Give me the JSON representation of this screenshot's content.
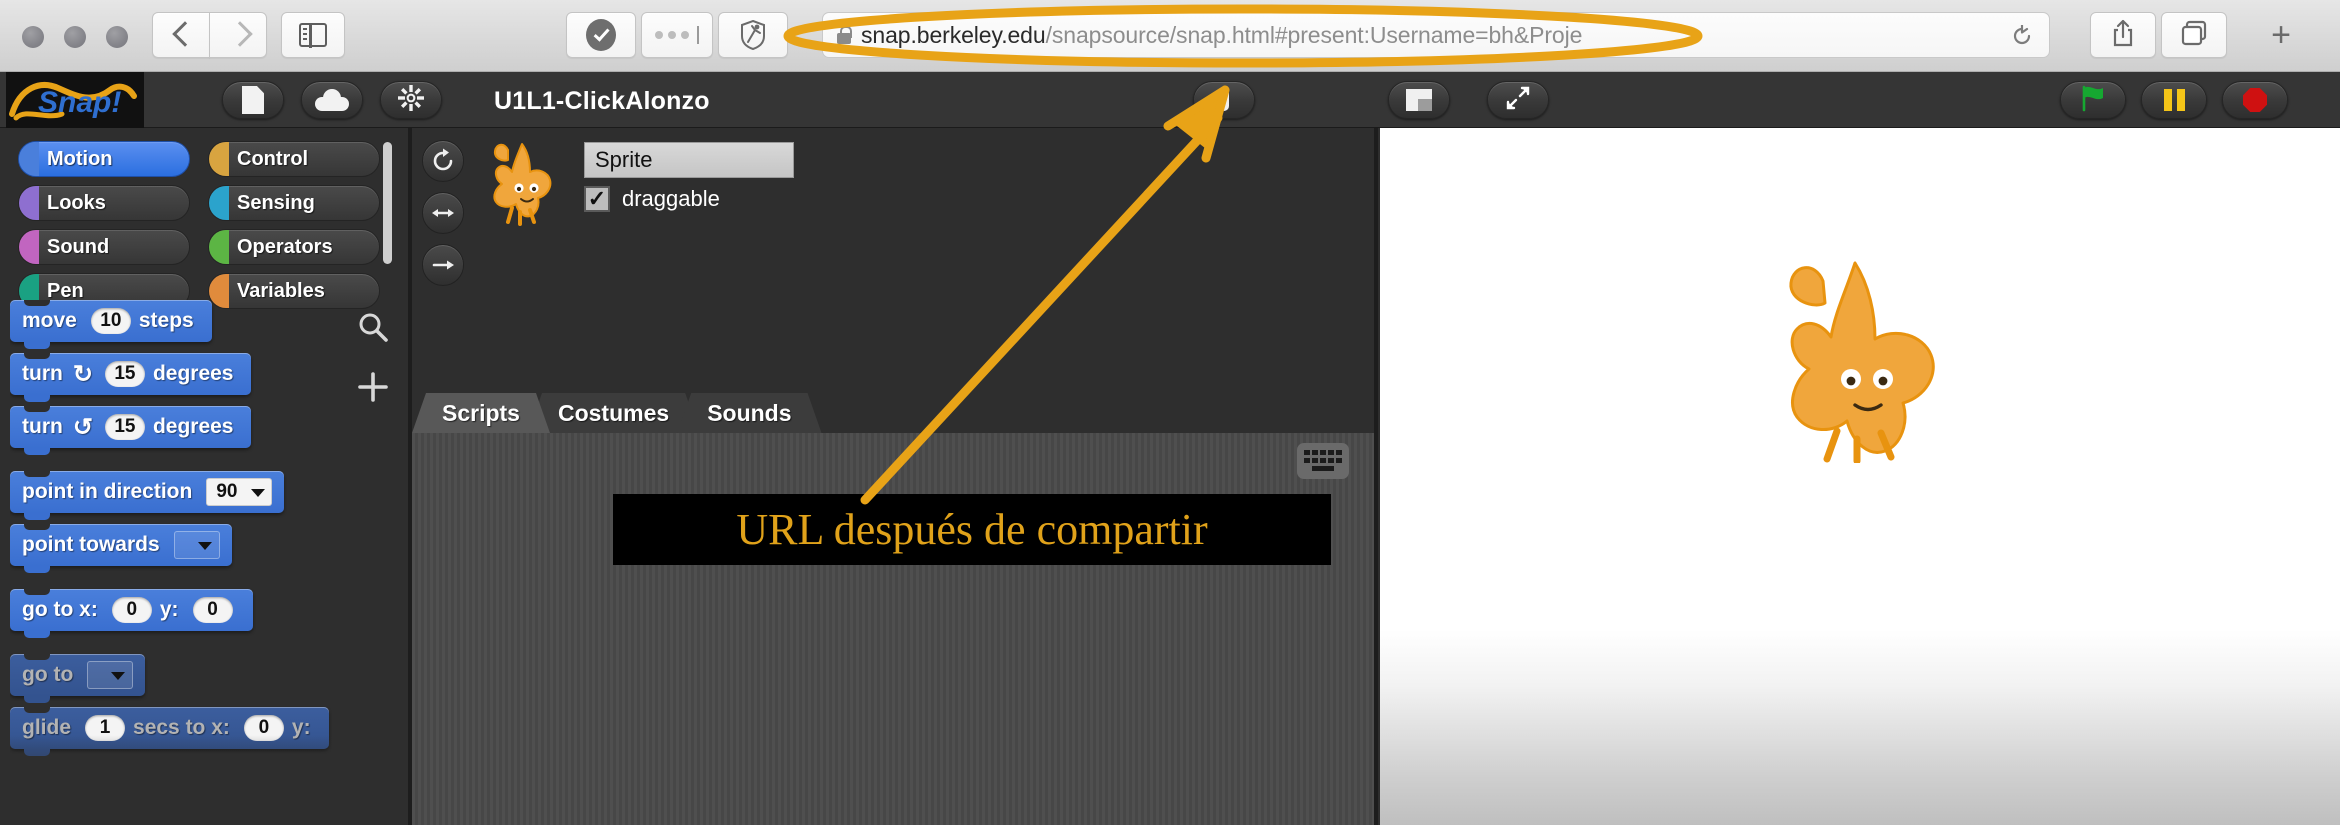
{
  "browser": {
    "traffic_lights": [
      "close",
      "minimize",
      "zoom"
    ],
    "nav": {
      "back": "back-icon",
      "forward": "forward-icon",
      "sidebar": "sidebar-icon"
    },
    "toolbar_icons": [
      "checkmark-circle-icon",
      "three-dots-icon",
      "shield-runner-icon"
    ],
    "address": {
      "lock": "lock-icon",
      "domain": "snap.berkeley.edu",
      "path": "/snapsource/snap.html#present:Username=bh&Proje",
      "full": "snap.berkeley.edu/snapsource/snap.html#present:Username=bh&Proje",
      "reload": "reload-icon"
    },
    "right_icons": [
      "share-icon",
      "tabs-icon",
      "new-tab-plus-icon"
    ]
  },
  "snap": {
    "logo": "snap-logo",
    "toolbar": {
      "file_button": "file-icon",
      "cloud_button": "cloud-icon",
      "settings_button": "gear-icon",
      "project_title": "U1L1-ClickAlonzo",
      "visible_stepping_button": "stepping-icon",
      "stage_size_button": "stage-size-icon",
      "fullscreen_button": "fullscreen-icon",
      "green_flag_button": "green-flag-icon",
      "pause_button": "pause-icon",
      "stop_button": "stop-icon"
    },
    "palette": {
      "categories": [
        {
          "label": "Motion",
          "color": "#4a7fdb",
          "selected": true
        },
        {
          "label": "Control",
          "color": "#d8a440",
          "selected": false
        },
        {
          "label": "Looks",
          "color": "#8e6fd0",
          "selected": false
        },
        {
          "label": "Sensing",
          "color": "#2ba3cc",
          "selected": false
        },
        {
          "label": "Sound",
          "color": "#c165c0",
          "selected": false
        },
        {
          "label": "Operators",
          "color": "#5cb544",
          "selected": false
        },
        {
          "label": "Pen",
          "color": "#1aa182",
          "selected": false
        },
        {
          "label": "Variables",
          "color": "#e08b3c",
          "selected": false
        }
      ],
      "tools": [
        "search-icon",
        "plus-icon"
      ],
      "blocks": [
        {
          "id": "move",
          "parts": [
            {
              "t": "text",
              "v": "move"
            },
            {
              "t": "num",
              "v": "10"
            },
            {
              "t": "text",
              "v": "steps"
            }
          ],
          "dim": false
        },
        {
          "id": "turn-right",
          "parts": [
            {
              "t": "text",
              "v": "turn"
            },
            {
              "t": "icon",
              "v": "↻"
            },
            {
              "t": "num",
              "v": "15"
            },
            {
              "t": "text",
              "v": "degrees"
            }
          ],
          "dim": false
        },
        {
          "id": "turn-left",
          "parts": [
            {
              "t": "text",
              "v": "turn"
            },
            {
              "t": "icon",
              "v": "↺"
            },
            {
              "t": "num",
              "v": "15"
            },
            {
              "t": "text",
              "v": "degrees"
            }
          ],
          "dim": false
        },
        {
          "id": "point-in-direction",
          "parts": [
            {
              "t": "text",
              "v": "point in direction"
            },
            {
              "t": "dropnum",
              "v": "90"
            }
          ],
          "dim": false
        },
        {
          "id": "point-towards",
          "parts": [
            {
              "t": "text",
              "v": "point towards"
            },
            {
              "t": "drop",
              "v": ""
            }
          ],
          "dim": false
        },
        {
          "id": "go-to-xy",
          "parts": [
            {
              "t": "text",
              "v": "go to x:"
            },
            {
              "t": "num",
              "v": "0"
            },
            {
              "t": "text",
              "v": "y:"
            },
            {
              "t": "num",
              "v": "0"
            }
          ],
          "dim": false
        },
        {
          "id": "go-to",
          "parts": [
            {
              "t": "text",
              "v": "go to"
            },
            {
              "t": "drop",
              "v": ""
            }
          ],
          "dim": true
        },
        {
          "id": "glide",
          "parts": [
            {
              "t": "text",
              "v": "glide"
            },
            {
              "t": "num",
              "v": "1"
            },
            {
              "t": "text",
              "v": "secs to x:"
            },
            {
              "t": "num",
              "v": "0"
            },
            {
              "t": "text",
              "v": "y:"
            }
          ],
          "dim": true
        }
      ]
    },
    "sprite": {
      "rotation_buttons": [
        "rotate-freely-icon",
        "rotate-left-right-icon",
        "rotate-none-icon"
      ],
      "thumbnail": "alonzo-sprite-icon",
      "name": "Sprite",
      "draggable_checked": true,
      "draggable_label": "draggable",
      "checkbox_glyph": "✓"
    },
    "tabs": [
      {
        "label": "Scripts",
        "active": true
      },
      {
        "label": "Costumes",
        "active": false
      },
      {
        "label": "Sounds",
        "active": false
      }
    ],
    "scripting": {
      "keyboard_button": "keyboard-icon",
      "annotation_text": "URL después  de compartir"
    },
    "stage": {
      "sprite": "alonzo-sprite-icon"
    }
  },
  "annotations": {
    "url_highlight_ellipse": "orange-ellipse-highlight",
    "arrow": "orange-arrow-pointer",
    "highlight_color": "#e8a317"
  }
}
